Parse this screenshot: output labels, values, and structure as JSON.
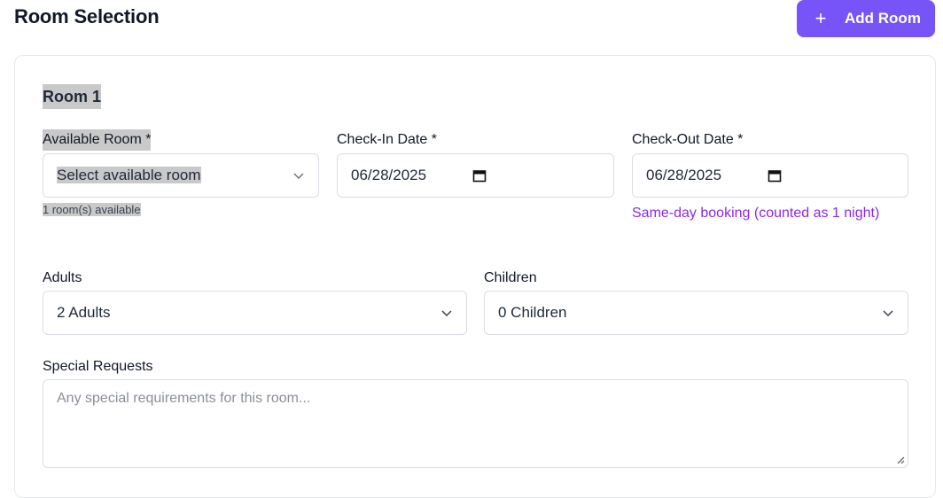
{
  "header": {
    "title": "Room Selection",
    "add_room_label": "Add Room",
    "add_icon": "plus-icon"
  },
  "room": {
    "title": "Room 1",
    "available_room": {
      "label": "Available Room *",
      "placeholder": "Select available room",
      "helper": "1 room(s) available"
    },
    "check_in": {
      "label": "Check-In Date *",
      "value": "06/28/2025"
    },
    "check_out": {
      "label": "Check-Out Date *",
      "value": "06/28/2025",
      "note": "Same-day booking (counted as 1 night)"
    },
    "adults": {
      "label": "Adults",
      "value": "2 Adults"
    },
    "children": {
      "label": "Children",
      "value": "0 Children"
    },
    "special_requests": {
      "label": "Special Requests",
      "placeholder": "Any special requirements for this room..."
    }
  },
  "colors": {
    "accent": "#7654f8",
    "warning_text": "#8b2be0",
    "highlight": "#c9c9c9"
  }
}
